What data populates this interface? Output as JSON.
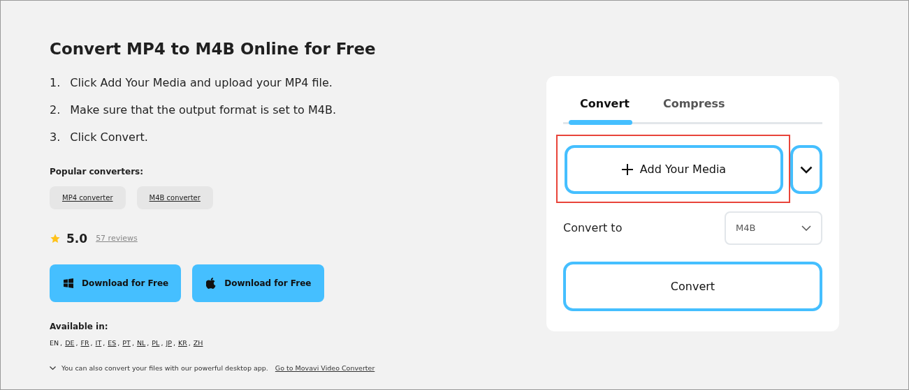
{
  "title": "Convert MP4 to M4B Online for Free",
  "steps": [
    {
      "number": "1.",
      "text": "Click Add Your Media and upload your MP4 file."
    },
    {
      "number": "2.",
      "text": "Make sure that the output format is set to M4B."
    },
    {
      "number": "3.",
      "text": "Click Convert."
    }
  ],
  "popular": {
    "heading": "Popular converters:",
    "links": [
      "MP4 converter",
      "M4B converter"
    ]
  },
  "rating": {
    "score": "5.0",
    "reviews": "57 reviews"
  },
  "downloads": [
    {
      "kind": "windows",
      "label": "Download for Free"
    },
    {
      "kind": "apple",
      "label": "Download for Free"
    }
  ],
  "languages": {
    "heading": "Available in:",
    "separator": ",",
    "items": [
      {
        "code": "EN",
        "selected": true
      },
      {
        "code": "DE",
        "selected": false
      },
      {
        "code": "FR",
        "selected": false
      },
      {
        "code": "IT",
        "selected": false
      },
      {
        "code": "ES",
        "selected": false
      },
      {
        "code": "PT",
        "selected": false
      },
      {
        "code": "NL",
        "selected": false
      },
      {
        "code": "PL",
        "selected": false
      },
      {
        "code": "JP",
        "selected": false
      },
      {
        "code": "KR",
        "selected": false
      },
      {
        "code": "ZH",
        "selected": false
      }
    ]
  },
  "note": {
    "text": "You can also convert your files with our powerful desktop app.",
    "link": "Go to Movavi Video Converter"
  },
  "panel": {
    "tabs": [
      {
        "label": "Convert",
        "selected": true
      },
      {
        "label": "Compress",
        "selected": false
      }
    ],
    "add_button": {
      "label": "Add Your Media",
      "highlighted": true
    },
    "convert_to": {
      "label": "Convert to",
      "value": "M4B"
    },
    "convert_button": "Convert"
  }
}
